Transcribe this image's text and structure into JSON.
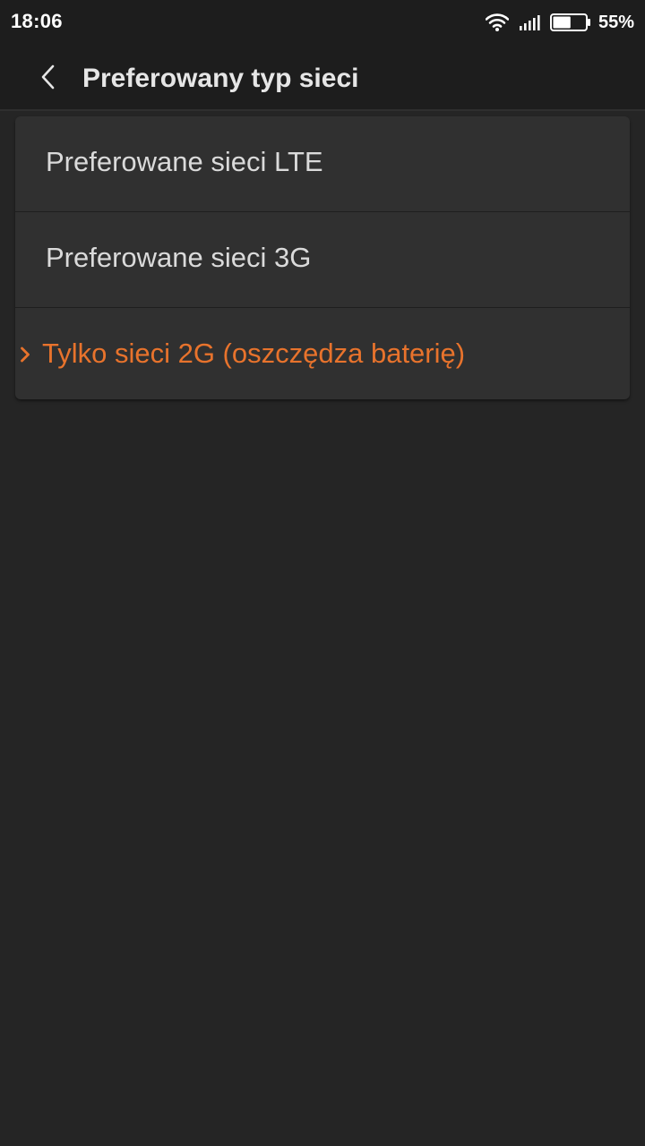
{
  "status_bar": {
    "time": "18:06",
    "battery_percent": "55%",
    "battery_level": 0.55,
    "icons": [
      "wifi-icon",
      "signal-icon",
      "battery-icon"
    ]
  },
  "header": {
    "back_icon": "chevron-left-icon",
    "title": "Preferowany typ sieci"
  },
  "options": {
    "items": [
      {
        "label": "Preferowane sieci LTE",
        "selected": false
      },
      {
        "label": "Preferowane sieci 3G",
        "selected": false
      },
      {
        "label": "Tylko sieci 2G (oszczędza baterię)",
        "selected": true
      }
    ],
    "selected_marker_icon": "chevron-right-icon"
  },
  "colors": {
    "background": "#252525",
    "bars": "#1d1d1d",
    "card": "#303030",
    "text": "#dadada",
    "accent": "#e8732c"
  }
}
